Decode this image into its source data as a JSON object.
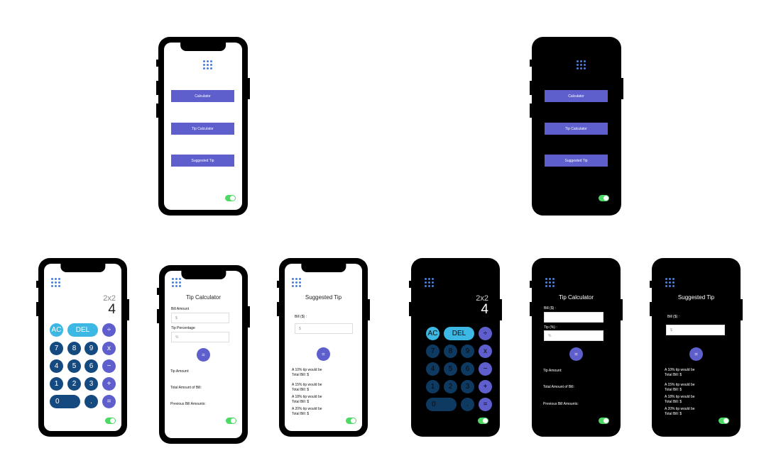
{
  "home": {
    "buttons": [
      "Calculator",
      "Tip Calculator",
      "Suggested Tip"
    ]
  },
  "calculator": {
    "expression": "2x2",
    "result": "4",
    "keys": {
      "ac": "AC",
      "del": "DEL",
      "divide": "÷",
      "k7": "7",
      "k8": "8",
      "k9": "9",
      "multiply": "x",
      "k4": "4",
      "k5": "5",
      "k6": "6",
      "minus": "−",
      "k1": "1",
      "k2": "2",
      "k3": "3",
      "plus": "+",
      "k0": "0",
      "dot": ".",
      "equals": "="
    }
  },
  "tip_light": {
    "title": "Tip Calculator",
    "bill_label": "Bill Amount",
    "bill_placeholder": "$",
    "tip_label": "Tip Percentage",
    "tip_placeholder": "%",
    "equals": "=",
    "tip_amount": "Tip Amount:",
    "total_amount": "Total Amount of Bill:",
    "previous": "Previous Bill Amounts:"
  },
  "tip_dark": {
    "title": "Tip Calculator",
    "bill_label": "Bill ($) :",
    "bill_placeholder": "",
    "tip_label": "Tip (%) :",
    "tip_placeholder": "%",
    "equals": "=",
    "tip_amount": "Tip Amount:",
    "total_amount": "Total Amount of Bill:",
    "previous": "Previous Bill Amounts:"
  },
  "suggested": {
    "title": "Suggested Tip",
    "bill_label": "Bill ($) :",
    "bill_placeholder": "$",
    "equals": "=",
    "results": [
      {
        "tip": "A 10% tip would be",
        "total": "Total Bill: $"
      },
      {
        "tip": "A 15% tip would be",
        "total": "Total Bill: $"
      },
      {
        "tip": "A 18% tip would be",
        "total": "Total Bill: $"
      },
      {
        "tip": "A 20% tip would be",
        "total": "Total Bill: $"
      }
    ]
  },
  "colors": {
    "primary": "#5e5fcc",
    "number_key": "#154a80",
    "accent_cyan": "#3db7e4",
    "toggle_on": "#4cd964",
    "logo": "#4a7fd8"
  },
  "icons": [
    "app-grid-logo-icon",
    "toggle-switch"
  ]
}
